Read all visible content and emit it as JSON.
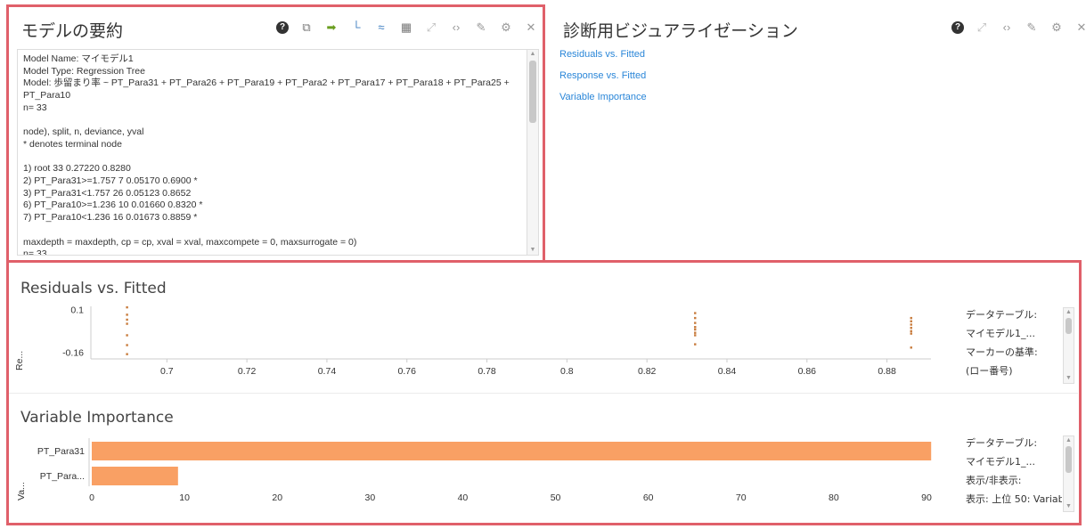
{
  "summary_panel": {
    "title": "モデルの要約",
    "text_lines": [
      "Model Name: マイモデル1",
      "Model Type: Regression Tree",
      "Model: 歩留まり率 ~ PT_Para31 + PT_Para26 + PT_Para19 + PT_Para2 + PT_Para17 + PT_Para18 + PT_Para25 + PT_Para10",
      "n= 33",
      "",
      "node), split, n, deviance, yval",
      "* denotes terminal node",
      "",
      "1) root 33 0.27220 0.8280",
      "2) PT_Para31>=1.757 7 0.05170 0.6900 *",
      "3) PT_Para31<1.757 26 0.05123 0.8652",
      "6) PT_Para10>=1.236 10 0.01660 0.8320 *",
      "7) PT_Para10<1.236 16 0.01673 0.8859 *",
      "",
      "maxdepth = maxdepth, cp = cp, xval = xval, maxcompete = 0, maxsurrogate = 0)",
      "n= 33"
    ]
  },
  "diagnostics_panel": {
    "title": "診断用ビジュアライゼーション",
    "links": [
      "Residuals vs. Fitted",
      "Response vs. Fitted",
      "Variable Importance"
    ]
  },
  "residuals_section": {
    "title": "Residuals vs. Fitted",
    "side": {
      "table_label": "データテーブル:",
      "table_value": "マイモデル1_...",
      "marker_label": "マーカーの基準:",
      "marker_value": "(ロー番号)"
    }
  },
  "importance_section": {
    "title": "Variable Importance",
    "side": {
      "table_label": "データテーブル:",
      "table_value": "マイモデル1_...",
      "toggle_label": "表示/非表示:",
      "toggle_value": "表示: 上位 50: Variabl"
    }
  },
  "colors": {
    "frame": "#e0606a",
    "link": "#2a86d8",
    "scatter_point": "#c87b3c",
    "bar": "#f9a064"
  },
  "chart_data": [
    {
      "type": "scatter",
      "title": "Residuals vs. Fitted",
      "xlabel": "",
      "ylabel": "Re...",
      "x_ticks": [
        0.7,
        0.72,
        0.74,
        0.76,
        0.78,
        0.8,
        0.82,
        0.84,
        0.86,
        0.88
      ],
      "y_ticks": [
        0.1,
        -0.16
      ],
      "xlim": [
        0.681,
        0.891
      ],
      "ylim": [
        -0.2,
        0.12
      ],
      "points": [
        {
          "x": 0.69,
          "y": 0.115
        },
        {
          "x": 0.69,
          "y": 0.07
        },
        {
          "x": 0.69,
          "y": 0.04
        },
        {
          "x": 0.69,
          "y": 0.015
        },
        {
          "x": 0.69,
          "y": -0.055
        },
        {
          "x": 0.69,
          "y": -0.115
        },
        {
          "x": 0.69,
          "y": -0.17
        },
        {
          "x": 0.832,
          "y": 0.08
        },
        {
          "x": 0.832,
          "y": 0.05
        },
        {
          "x": 0.832,
          "y": 0.02
        },
        {
          "x": 0.832,
          "y": -0.005
        },
        {
          "x": 0.832,
          "y": -0.02
        },
        {
          "x": 0.832,
          "y": -0.04
        },
        {
          "x": 0.832,
          "y": -0.055
        },
        {
          "x": 0.832,
          "y": -0.11
        },
        {
          "x": 0.886,
          "y": 0.05
        },
        {
          "x": 0.886,
          "y": 0.03
        },
        {
          "x": 0.886,
          "y": 0.01
        },
        {
          "x": 0.886,
          "y": -0.01
        },
        {
          "x": 0.886,
          "y": -0.03
        },
        {
          "x": 0.886,
          "y": -0.045
        },
        {
          "x": 0.886,
          "y": -0.13
        }
      ]
    },
    {
      "type": "bar",
      "orientation": "horizontal",
      "title": "Variable Importance",
      "ylabel": "Va...",
      "categories": [
        "PT_Para31",
        "PT_Para..."
      ],
      "values": [
        90.5,
        9.3
      ],
      "x_ticks": [
        0,
        10,
        20,
        30,
        40,
        50,
        60,
        70,
        80,
        90
      ],
      "xlim": [
        0,
        90
      ]
    }
  ]
}
